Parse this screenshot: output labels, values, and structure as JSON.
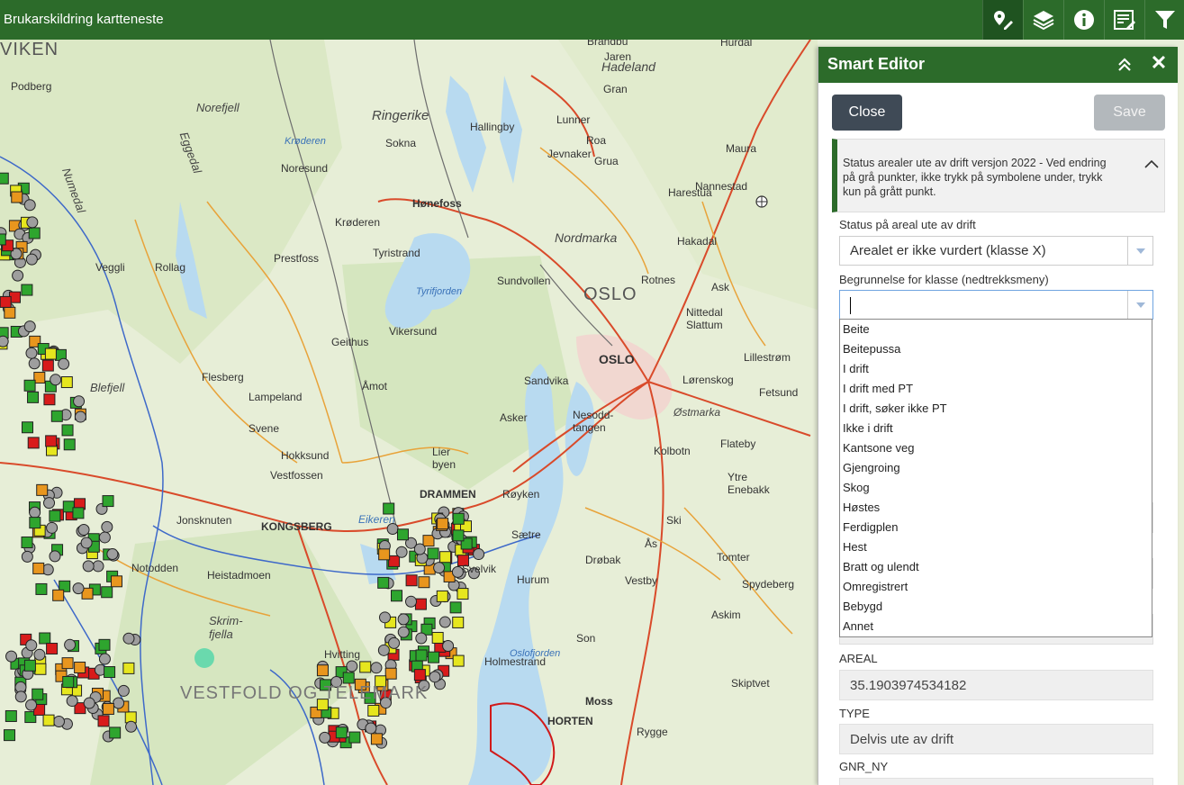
{
  "app": {
    "title": "Brukarskildring kartteneste"
  },
  "toolbar": {
    "tools": [
      {
        "name": "smart-editor-tool",
        "icon": "edit-pin-icon",
        "active": true
      },
      {
        "name": "layers-tool",
        "icon": "layers-icon",
        "active": false
      },
      {
        "name": "info-tool",
        "icon": "info-icon",
        "active": false
      },
      {
        "name": "report-tool",
        "icon": "list-edit-icon",
        "active": false
      },
      {
        "name": "filter-tool",
        "icon": "filter-icon",
        "active": false
      }
    ]
  },
  "map": {
    "labels": {
      "viken": "VIKEN",
      "oslo_region": "OSLO",
      "oslo_city": "OSLO",
      "drammen": "DRAMMEN",
      "kongsberg": "KONGSBERG",
      "horten": "HORTEN",
      "vestfold": "VESTFOLD OG TELEMARK",
      "ringerike": "Ringerike",
      "hadeland": "Hadeland",
      "nordmarka": "Nordmarka",
      "norefjell": "Norefjell",
      "numedal": "Numedal",
      "honefoss": "Hønefoss",
      "sokna": "Sokna",
      "noresund": "Noresund",
      "kroderen": "Krøderen",
      "tyristrand": "Tyristrand",
      "prestfoss": "Prestfoss",
      "veggli": "Veggli",
      "rollag": "Rollag",
      "sundvollen": "Sundvollen",
      "vikersund": "Vikersund",
      "geithus": "Geithus",
      "amot": "Åmot",
      "sandvika": "Sandvika",
      "asker": "Asker",
      "nesodd": "Nesodd-\ntangen",
      "lier": "Lier\nbyen",
      "royken": "Røyken",
      "saetre": "Sætre",
      "hurum": "Hurum",
      "svelvik": "Svelvik",
      "drobak": "Drøbak",
      "hokksund": "Hokksund",
      "vestfossen": "Vestfossen",
      "flesberg": "Flesberg",
      "lampeland": "Lampeland",
      "svene": "Svene",
      "blefjell": "Blefjell",
      "notodden": "Notodden",
      "heistadmoen": "Heistadmoen",
      "skrim": "Skrim-\nfjella",
      "jonsknuten": "Jonsknuten",
      "kolbotn": "Kolbotn",
      "ski": "Ski",
      "moss": "Moss",
      "rygge": "Rygge",
      "son": "Son",
      "vestby": "Vestby",
      "askim": "Askim",
      "spydeberg": "Spydeberg",
      "tomter": "Tomter",
      "holmestrand": "Holmestrand",
      "hvitting": "Hvitting",
      "oslofjorden": "Oslofjorden",
      "tyrifjorden": "Tyrifjorden",
      "jevnaker": "Jevnaker",
      "grua": "Grua",
      "roa": "Roa",
      "lunner": "Lunner",
      "hallingby": "Hallingby",
      "harestua": "Harestua",
      "nannestad": "Nannestad",
      "hakadal": "Hakadal",
      "rotnes": "Rotnes",
      "ask": "Ask",
      "nittedal": "Nittedal\nSlattum",
      "lillestrom": "Lillestrøm",
      "lorenskog": "Lørenskog",
      "fetsund": "Fetsund",
      "flateby": "Flateby",
      "ostmarka": "Østmarka",
      "ytre": "Ytre\nEnebakk",
      "as": "Ås",
      "skiptvet": "Skiptvet",
      "maura": "Maura",
      "hurdal": "Hurdal",
      "gran": "Gran",
      "jaren": "Jaren",
      "brandbu": "Brandbu",
      "podberg": "Podberg",
      "eggedal": "Eggedal",
      "eikeren": "Eikeren"
    }
  },
  "panel": {
    "title": "Smart Editor",
    "close_label": "Close",
    "save_label": "Save",
    "layer_description": "Status arealer ute av drift versjon 2022 - Ved endring på grå punkter, ikke trykk på symbolene under, trykk kun på grått punkt.",
    "status_label": "Status på areal ute av drift",
    "status_value": "Arealet er ikke vurdert (klasse X)",
    "reason_label": "Begrunnelse for klasse (nedtrekksmeny)",
    "reason_value": "",
    "reason_options": [
      "Beite",
      "Beitepussa",
      "I drift",
      "I drift med PT",
      "I drift, søker ikke PT",
      "Ikke i drift",
      "Kantsone veg",
      "Gjengroing",
      "Skog",
      "Høstes",
      "Ferdigplen",
      "Hest",
      "Bratt og ulendt",
      "Omregistrert",
      "Bebygd",
      "Annet"
    ],
    "areal_label": "AREAL",
    "areal_value": "35.1903974534182",
    "type_label": "TYPE",
    "type_value": "Delvis ute av drift",
    "gnr_label": "GNR_NY"
  },
  "colors": {
    "header_green": "#2c6b2a",
    "close_button": "#3f4a56",
    "save_button_disabled": "#b3b8bc"
  }
}
